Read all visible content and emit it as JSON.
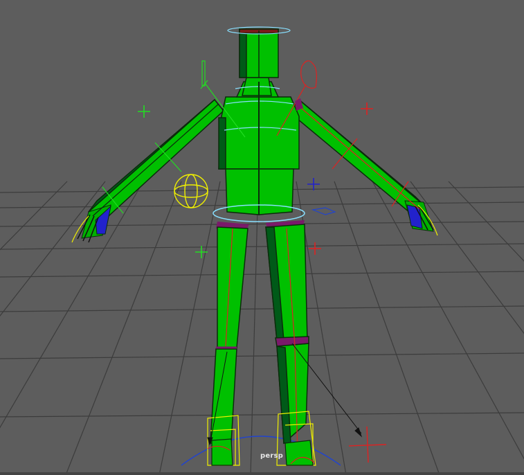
{
  "viewport": {
    "camera_name": "persp",
    "colors": {
      "background": "#5d5d5d",
      "grid": "#3c3c3c",
      "mesh": "#00c000",
      "mesh_shade": "#005a18",
      "outline": "#0b2b0b",
      "joint_purple": "#7a1a6a",
      "control_yellow": "#f0f000",
      "control_red": "#dd2222",
      "control_blue": "#2222cc",
      "control_green": "#22dd22",
      "control_cyan": "#88e0ff"
    }
  }
}
